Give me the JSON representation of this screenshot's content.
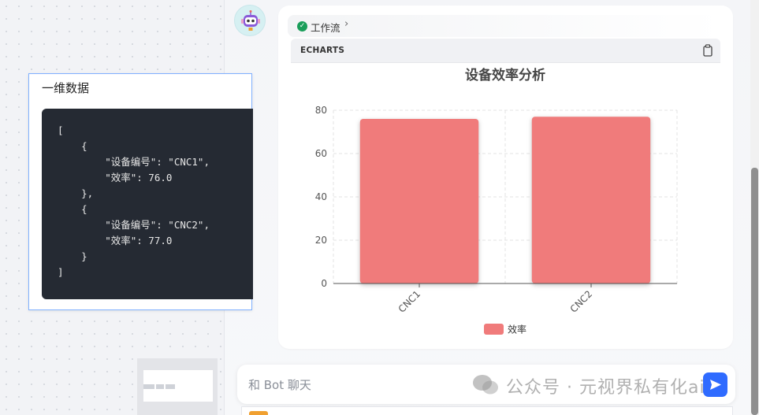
{
  "canvas": {
    "node": {
      "title": "一维数据",
      "code": "[\n    {\n        \"设备编号\": \"CNC1\",\n        \"效率\": 76.0\n    },\n    {\n        \"设备编号\": \"CNC2\",\n        \"效率\": 77.0\n    }\n]"
    }
  },
  "chat": {
    "workflow_label": "工作流",
    "block_label": "ECHARTS",
    "input_placeholder": "和 Bot 聊天",
    "watermark": "公众号 · 元视界私有化ai"
  },
  "chart_data": {
    "type": "bar",
    "title": "设备效率分析",
    "categories": [
      "CNC1",
      "CNC2"
    ],
    "series": [
      {
        "name": "效率",
        "values": [
          76.0,
          77.0
        ],
        "color": "#f07b7b"
      }
    ],
    "ylim": [
      0,
      80
    ],
    "yticks": [
      0,
      20,
      40,
      60,
      80
    ],
    "grid": true,
    "legend": "bottom-center",
    "xlabel": "",
    "ylabel": ""
  }
}
